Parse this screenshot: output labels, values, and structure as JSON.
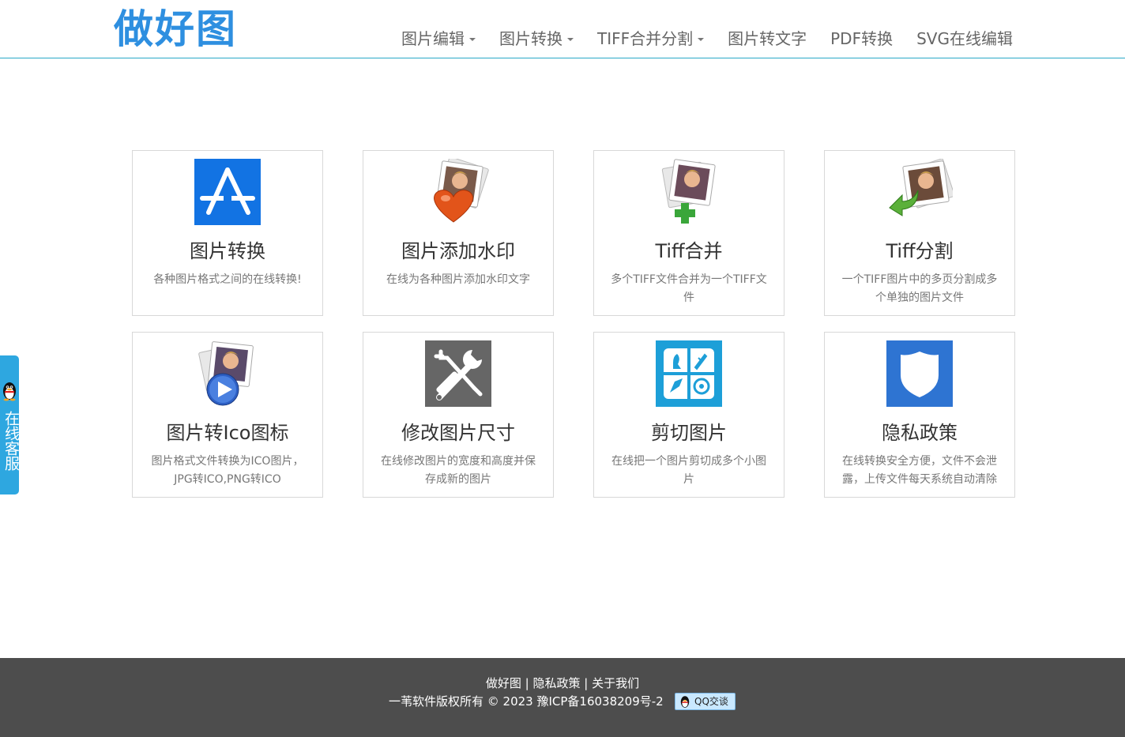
{
  "header": {
    "logo": "做好图",
    "nav": [
      {
        "label": "图片编辑",
        "dropdown": true
      },
      {
        "label": "图片转换",
        "dropdown": true
      },
      {
        "label": "TIFF合并分割",
        "dropdown": true
      },
      {
        "label": "图片转文字",
        "dropdown": false
      },
      {
        "label": "PDF转换",
        "dropdown": false
      },
      {
        "label": "SVG在线编辑",
        "dropdown": false
      }
    ]
  },
  "cards": [
    {
      "icon": "app-store-icon",
      "title": "图片转换",
      "desc": "各种图片格式之间的在线转换!"
    },
    {
      "icon": "photo-heart-icon",
      "title": "图片添加水印",
      "desc": "在线为各种图片添加水印文字"
    },
    {
      "icon": "photo-plus-icon",
      "title": "Tiff合并",
      "desc": "多个TIFF文件合并为一个TIFF文件"
    },
    {
      "icon": "photo-arrow-icon",
      "title": "Tiff分割",
      "desc": "一个TIFF图片中的多页分割成多个单独的图片文件"
    },
    {
      "icon": "photo-play-icon",
      "title": "图片转Ico图标",
      "desc": "图片格式文件转换为ICO图片，JPG转ICO,PNG转ICO"
    },
    {
      "icon": "tools-icon",
      "title": "修改图片尺寸",
      "desc": "在线修改图片的宽度和高度并保存成新的图片"
    },
    {
      "icon": "crop-tools-icon",
      "title": "剪切图片",
      "desc": "在线把一个图片剪切成多个小图片"
    },
    {
      "icon": "shield-icon",
      "title": "隐私政策",
      "desc": "在线转换安全方便，文件不会泄露，上传文件每天系统自动清除"
    }
  ],
  "side_tab": {
    "label": "在线客服"
  },
  "footer": {
    "links": [
      "做好图",
      "隐私政策",
      "关于我们"
    ],
    "separator": "|",
    "copyright": "一苇软件版权所有 © 2023 豫ICP备16038209号-2",
    "qq_button": "QQ交谈"
  },
  "colors": {
    "brand": "#2e8fe0",
    "header_border": "#2aa9c7",
    "footer_bg": "#4d4d4d",
    "side_tab": "#2ea7e0"
  }
}
